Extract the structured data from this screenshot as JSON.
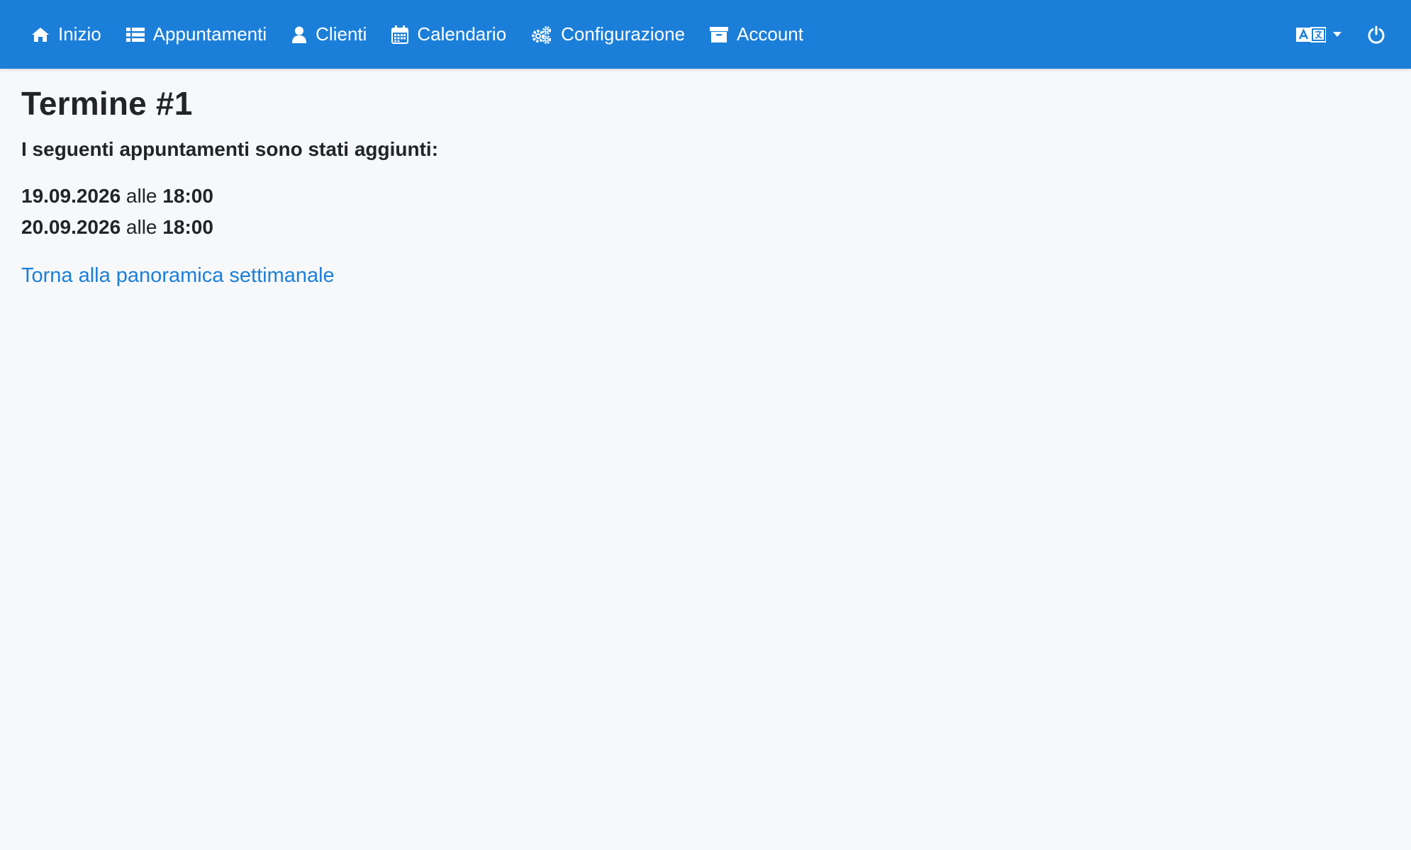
{
  "nav": {
    "items": [
      {
        "label": "Inizio",
        "icon": "home-icon"
      },
      {
        "label": "Appuntamenti",
        "icon": "list-icon"
      },
      {
        "label": "Clienti",
        "icon": "user-icon"
      },
      {
        "label": "Calendario",
        "icon": "calendar-icon"
      },
      {
        "label": "Configurazione",
        "icon": "gears-icon"
      },
      {
        "label": "Account",
        "icon": "archive-icon"
      }
    ],
    "language_icon": "language-icon",
    "power_icon": "power-icon",
    "accent_color": "#1b7fd9"
  },
  "page": {
    "title": "Termine #1",
    "subtitle": "I seguenti appuntamenti sono stati aggiunti:",
    "appointments": [
      {
        "date": "19.09.2026",
        "connector": "alle",
        "time": "18:00"
      },
      {
        "date": "20.09.2026",
        "connector": "alle",
        "time": "18:00"
      }
    ],
    "back_link": "Torna alla panoramica settimanale"
  }
}
